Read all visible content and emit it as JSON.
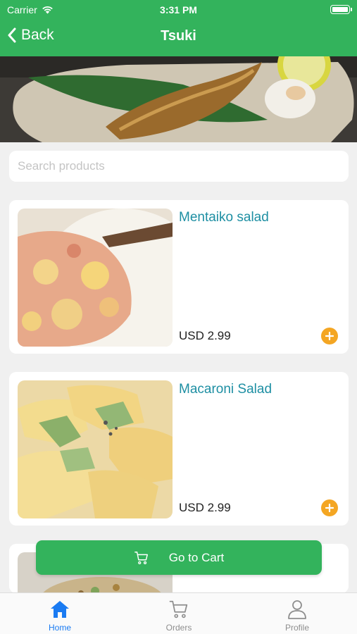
{
  "status_bar": {
    "carrier": "Carrier",
    "time": "3:31 PM"
  },
  "nav": {
    "back_label": "Back",
    "title": "Tsuki"
  },
  "search": {
    "placeholder": "Search products",
    "value": ""
  },
  "products": [
    {
      "name": "Mentaiko salad",
      "price": "USD 2.99"
    },
    {
      "name": "Macaroni Salad",
      "price": "USD 2.99"
    },
    {
      "name": "",
      "price": ""
    }
  ],
  "cart_button": {
    "label": "Go to Cart"
  },
  "tabs": [
    {
      "label": "Home",
      "icon": "home-icon",
      "active": true
    },
    {
      "label": "Orders",
      "icon": "cart-icon",
      "active": false
    },
    {
      "label": "Profile",
      "icon": "profile-icon",
      "active": false
    }
  ],
  "colors": {
    "brand": "#33b35c",
    "product_title": "#1e8fa3",
    "add_button": "#f4a623",
    "active_tab": "#1a7bf2"
  }
}
